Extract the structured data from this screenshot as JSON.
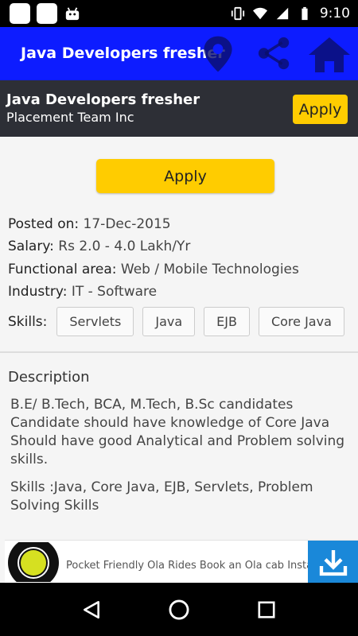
{
  "status_bar": {
    "time": "9:10"
  },
  "app_bar": {
    "title": "Java Developers fresher",
    "icons": [
      "location-pin-icon",
      "share-icon",
      "home-icon"
    ]
  },
  "job_header": {
    "title": "Java Developers fresher",
    "company": "Placement Team Inc",
    "apply_label": "Apply"
  },
  "main": {
    "apply_label": "Apply",
    "posted_on": {
      "label": "Posted on:",
      "value": "17-Dec-2015"
    },
    "salary": {
      "label": "Salary:",
      "value": "Rs 2.0 - 4.0 Lakh/Yr"
    },
    "functional_area": {
      "label": "Functional area:",
      "value": "Web / Mobile Technologies"
    },
    "industry": {
      "label": "Industry:",
      "value": "IT - Software"
    },
    "skills_label": "Skills:",
    "skills": [
      "Servlets",
      "Java",
      "EJB",
      "Core Java"
    ],
    "description_title": "Description",
    "description_paragraphs": [
      "B.E/ B.Tech, BCA, M.Tech, B.Sc candidates Candidate should have knowledge of Core Java Should have good Analytical and Problem solving skills.",
      "Skills :Java, Core Java, EJB, Servlets, Problem Solving Skills"
    ]
  },
  "ad": {
    "text": "Pocket Friendly Ola Rides Book an Ola cab Instantly",
    "icon": "download-icon"
  },
  "nav_bar": {
    "icons": [
      "back-icon",
      "home-circle-icon",
      "recents-icon"
    ]
  },
  "colors": {
    "app_bar": "#0d1cff",
    "header_bg": "#2d2f36",
    "button_yellow": "#ffcc00",
    "ad_blue": "#1a88d9"
  }
}
